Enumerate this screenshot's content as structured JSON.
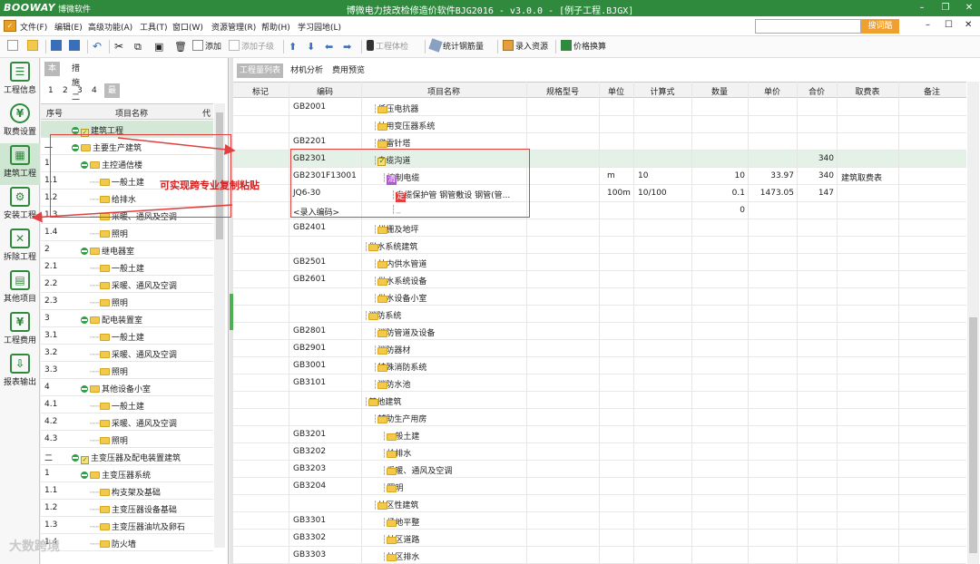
{
  "titlebar": {
    "logo": "BOOWAY",
    "logo_cn": "博微软件",
    "title": "博微电力技改检修造价软件BJG2016 - v3.0.0 - [例子工程.BJGX]",
    "min": "–",
    "restore": "❐",
    "close": "✕"
  },
  "menu": {
    "items": [
      "文件(F)",
      "编辑(E)",
      "高级功能(A)",
      "工具(T)",
      "窗口(W)",
      "资源管理(R)",
      "帮助(H)",
      "学习园地(L)"
    ],
    "search_placeholder": "",
    "search_button": "搜词酷",
    "ctl_min": "–",
    "ctl_max": "☐",
    "ctl_close": "✕"
  },
  "toolbar": {
    "add": "添加",
    "add_child": "添加子级",
    "inspect": "工程体检",
    "rebar": "统计钢筋量",
    "resource": "录入资源",
    "price_swap": "价格换算"
  },
  "sidebar": [
    {
      "label": "工程信息",
      "icon": "☰"
    },
    {
      "label": "取费设置",
      "icon": "¥"
    },
    {
      "label": "建筑工程",
      "icon": "▦"
    },
    {
      "label": "安装工程",
      "icon": "⚙"
    },
    {
      "label": "拆除工程",
      "icon": "✕"
    },
    {
      "label": "其他项目",
      "icon": "▤"
    },
    {
      "label": "工程费用",
      "icon": "¥"
    },
    {
      "label": "报表输出",
      "icon": "⇩"
    }
  ],
  "left_panel": {
    "tabs": [
      "本体",
      "措施二"
    ],
    "levels": [
      "1",
      "2",
      "3",
      "4",
      "最小级"
    ],
    "headers": {
      "no": "序号",
      "name": "项目名称",
      "code": "代"
    },
    "rows": [
      {
        "no": "",
        "name": "建筑工程",
        "kind": "check-collapse",
        "indent": 0
      },
      {
        "no": "一",
        "name": "主要生产建筑",
        "kind": "collapse",
        "indent": 0
      },
      {
        "no": "1",
        "name": "主控通信楼",
        "kind": "collapse",
        "indent": 1
      },
      {
        "no": "1.1",
        "name": "一般土建",
        "kind": "leaf",
        "indent": 2
      },
      {
        "no": "1.2",
        "name": "给排水",
        "kind": "leaf",
        "indent": 2
      },
      {
        "no": "1.3",
        "name": "采暖、通风及空调",
        "kind": "leaf",
        "indent": 2
      },
      {
        "no": "1.4",
        "name": "照明",
        "kind": "leaf",
        "indent": 2
      },
      {
        "no": "2",
        "name": "继电器室",
        "kind": "collapse",
        "indent": 1
      },
      {
        "no": "2.1",
        "name": "一般土建",
        "kind": "leaf",
        "indent": 2
      },
      {
        "no": "2.2",
        "name": "采暖、通风及空调",
        "kind": "leaf",
        "indent": 2
      },
      {
        "no": "2.3",
        "name": "照明",
        "kind": "leaf",
        "indent": 2
      },
      {
        "no": "3",
        "name": "配电装置室",
        "kind": "collapse",
        "indent": 1
      },
      {
        "no": "3.1",
        "name": "一般土建",
        "kind": "leaf",
        "indent": 2
      },
      {
        "no": "3.2",
        "name": "采暖、通风及空调",
        "kind": "leaf",
        "indent": 2
      },
      {
        "no": "3.3",
        "name": "照明",
        "kind": "leaf",
        "indent": 2
      },
      {
        "no": "4",
        "name": "其他设备小室",
        "kind": "collapse",
        "indent": 1
      },
      {
        "no": "4.1",
        "name": "一般土建",
        "kind": "leaf",
        "indent": 2
      },
      {
        "no": "4.2",
        "name": "采暖、通风及空调",
        "kind": "leaf",
        "indent": 2
      },
      {
        "no": "4.3",
        "name": "照明",
        "kind": "leaf",
        "indent": 2
      },
      {
        "no": "二",
        "name": "主变压器及配电装置建筑",
        "kind": "check-collapse",
        "indent": 0
      },
      {
        "no": "1",
        "name": "主变压器系统",
        "kind": "collapse",
        "indent": 1
      },
      {
        "no": "1.1",
        "name": "构支架及基础",
        "kind": "leaf",
        "indent": 2
      },
      {
        "no": "1.2",
        "name": "主变压器设备基础",
        "kind": "leaf",
        "indent": 2
      },
      {
        "no": "1.3",
        "name": "主变压器油坑及卵石",
        "kind": "leaf",
        "indent": 2
      },
      {
        "no": "1.4",
        "name": "防火墙",
        "kind": "leaf",
        "indent": 2
      }
    ]
  },
  "main_panel": {
    "tabs": [
      "工程量列表",
      "材机分析",
      "费用预览"
    ],
    "headers": [
      "标记",
      "编码",
      "项目名称",
      "规格型号",
      "单位",
      "计算式",
      "数量",
      "单价",
      "合价",
      "取费表",
      "备注"
    ],
    "rows": [
      {
        "code": "GB2001",
        "name": "低压电抗器",
        "kind": "leaf",
        "indent": 1
      },
      {
        "code": "",
        "name": "站用变压器系统",
        "kind": "expand",
        "indent": 1
      },
      {
        "code": "GB2201",
        "name": "避雷针塔",
        "kind": "leaf",
        "indent": 1
      },
      {
        "code": "GB2301",
        "name": "电缆沟道",
        "kind": "check-collapse",
        "indent": 1,
        "total": "340",
        "hl": true
      },
      {
        "code": "GB2301F13001",
        "name": "控制电缆",
        "kind": "qing",
        "indent": 2,
        "unit": "m",
        "formula": "10",
        "qty": "10",
        "price": "33.97",
        "total": "340",
        "fee": "建筑取费表"
      },
      {
        "code": "JQ6-30",
        "name": "电缆保护管 钢管敷设 钢管(管...",
        "kind": "ding",
        "indent": 3,
        "unit": "100m",
        "formula": "10/100",
        "qty": "0.1",
        "price": "1473.05",
        "total": "147"
      },
      {
        "code": "<录入编码>",
        "name": "",
        "kind": "empty",
        "indent": 3,
        "qty": "0"
      },
      {
        "code": "GB2401",
        "name": "栏栅及地坪",
        "kind": "leaf",
        "indent": 1
      },
      {
        "code": "",
        "name": "供水系统建筑",
        "kind": "collapse",
        "indent": 0
      },
      {
        "code": "GB2501",
        "name": "站内供水管道",
        "kind": "leaf",
        "indent": 1
      },
      {
        "code": "GB2601",
        "name": "供水系统设备",
        "kind": "leaf",
        "indent": 1
      },
      {
        "code": "",
        "name": "供水设备小室",
        "kind": "expand",
        "indent": 1
      },
      {
        "code": "",
        "name": "消防系统",
        "kind": "collapse",
        "indent": 0
      },
      {
        "code": "GB2801",
        "name": "消防管道及设备",
        "kind": "leaf",
        "indent": 1
      },
      {
        "code": "GB2901",
        "name": "消防器材",
        "kind": "leaf",
        "indent": 1
      },
      {
        "code": "GB3001",
        "name": "特殊消防系统",
        "kind": "leaf",
        "indent": 1
      },
      {
        "code": "GB3101",
        "name": "消防水池",
        "kind": "leaf",
        "indent": 1
      },
      {
        "code": "",
        "name": "其他建筑",
        "kind": "collapse",
        "indent": 0
      },
      {
        "code": "",
        "name": "辅助生产用房",
        "kind": "collapse",
        "indent": 1
      },
      {
        "code": "GB3201",
        "name": "一般土建",
        "kind": "leaf",
        "indent": 2
      },
      {
        "code": "GB3202",
        "name": "给排水",
        "kind": "leaf",
        "indent": 2
      },
      {
        "code": "GB3203",
        "name": "采暖、通风及空调",
        "kind": "leaf",
        "indent": 2
      },
      {
        "code": "GB3204",
        "name": "照明",
        "kind": "leaf",
        "indent": 2
      },
      {
        "code": "",
        "name": "站区性建筑",
        "kind": "collapse",
        "indent": 1
      },
      {
        "code": "GB3301",
        "name": "场地平整",
        "kind": "leaf",
        "indent": 2
      },
      {
        "code": "GB3302",
        "name": "站区道路",
        "kind": "leaf",
        "indent": 2
      },
      {
        "code": "GB3303",
        "name": "站区排水",
        "kind": "leaf",
        "indent": 2
      }
    ]
  },
  "annotation": {
    "text": "可实现跨专业复制粘贴",
    "color": "#d02020"
  },
  "watermark": "大数跨境",
  "colors": {
    "brand": "#2f8a3e",
    "highlight": "#d3e8d7",
    "search_button": "#f0a030"
  }
}
